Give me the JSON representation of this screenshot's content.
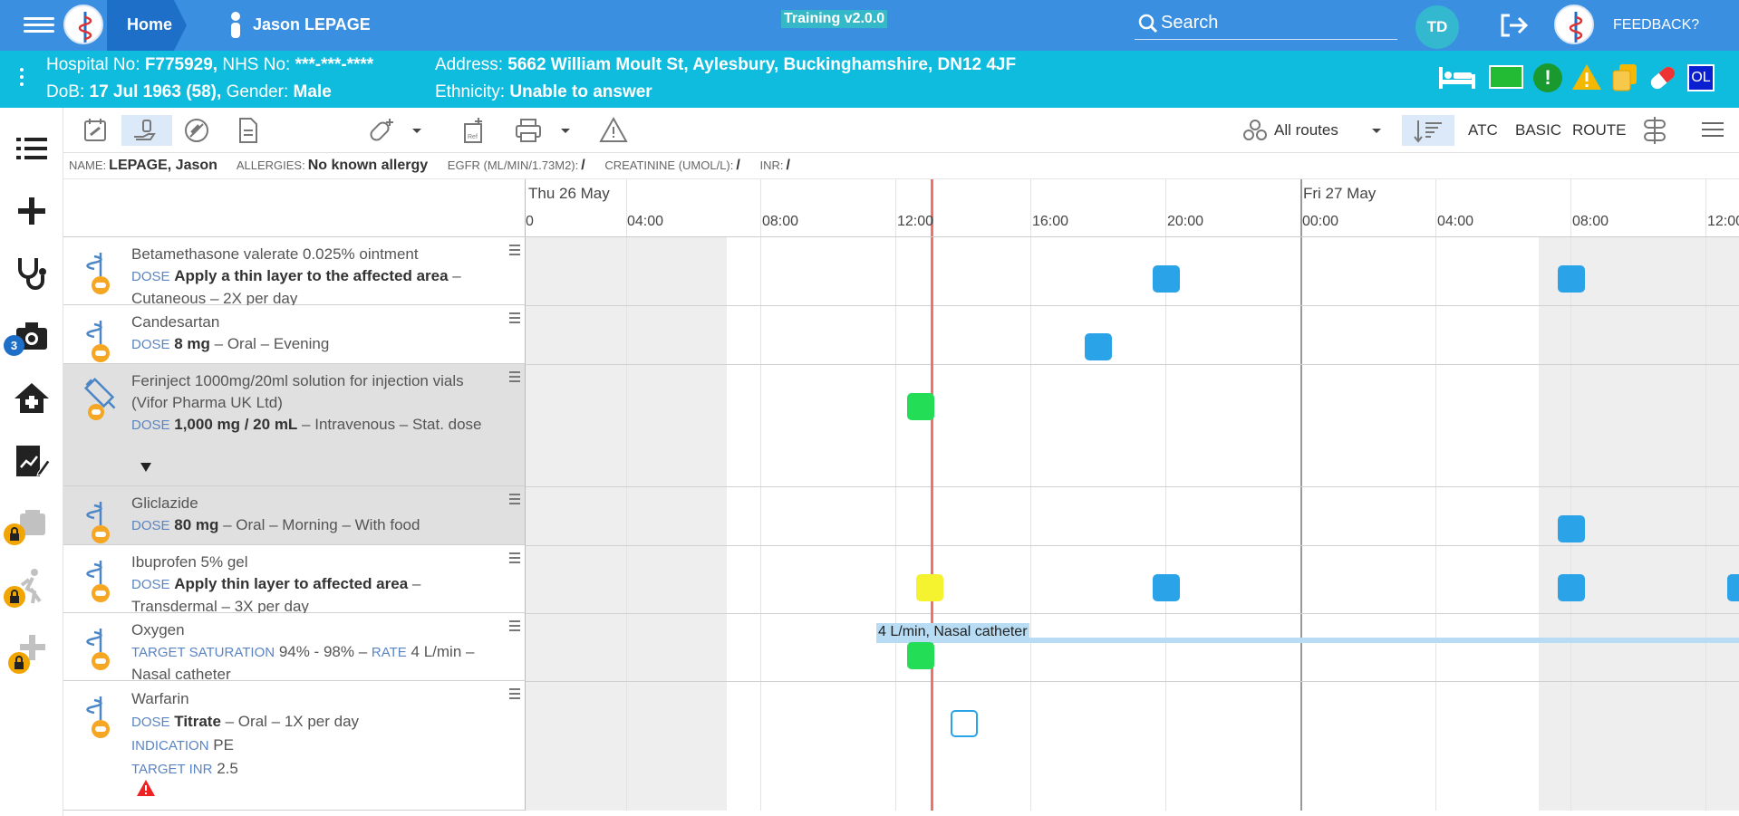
{
  "topbar": {
    "home_label": "Home",
    "patient_name": "Jason LEPAGE",
    "training_label": "Training v2.0.0",
    "search_placeholder": "Search",
    "user_initials": "TD",
    "feedback_label": "FEEDBACK?"
  },
  "patient": {
    "hospital_no_label": "Hospital No:",
    "hospital_no": "F775929,",
    "nhs_label": "NHS No:",
    "nhs_no": "***-***-****",
    "dob_label": "DoB:",
    "dob": "17 Jul 1963 (58),",
    "gender_label": "Gender:",
    "gender": "Male",
    "address_label": "Address:",
    "address": "5662 William Moult St, Aylesbury, Buckinghamshire, DN12 4JF",
    "ethnicity_label": "Ethnicity:",
    "ethnicity": "Unable to answer",
    "status_icons": [
      "bed-icon",
      "green-card-icon",
      "alert-circle-icon",
      "warning-icon",
      "documents-icon",
      "pill-icon",
      "ol-badge"
    ],
    "ol_badge": "OL"
  },
  "sidebar": {
    "camera_badge": "3",
    "icons": [
      "list-icon",
      "plus-icon",
      "stethoscope-icon",
      "camera-icon",
      "home-icon",
      "chart-edit-icon",
      "locked-chart-icon",
      "locked-walk-icon",
      "locked-add-icon"
    ]
  },
  "toolbar": {
    "route_filter": "All routes",
    "sort_atc": "ATC",
    "sort_basic": "BASIC",
    "sort_route": "ROUTE"
  },
  "infobar": {
    "name_label": "NAME:",
    "name": "LEPAGE, Jason",
    "allergies_label": "ALLERGIES:",
    "allergies": "No known allergy",
    "egfr_label": "EGFR (ML/MIN/1.73M2):",
    "egfr": "/",
    "creat_label": "CREATININE (UMOL/L):",
    "creat": "/",
    "inr_label": "INR:",
    "inr": "/"
  },
  "timeline": {
    "days": [
      "Thu 26 May",
      "Fri 27 May"
    ],
    "hours": [
      "0",
      "04:00",
      "08:00",
      "12:00",
      "16:00",
      "20:00",
      "00:00",
      "04:00",
      "08:00",
      "12:00"
    ]
  },
  "drugs": [
    {
      "name": "Betamethasone valerate 0.025% ointment",
      "k1": "DOSE",
      "v1": "Apply a thin layer to the affected area",
      "t1": " – Cutaneous – 2X per day"
    },
    {
      "name": "Candesartan",
      "k1": "DOSE",
      "v1": "8 mg",
      "t1": " – Oral – Evening"
    },
    {
      "name": "Ferinject 1000mg/20ml solution for injection vials (Vifor Pharma UK Ltd)",
      "k1": "DOSE",
      "v1": "1,000 mg / 20 mL",
      "t1": " – Intravenous – Stat. dose"
    },
    {
      "name": "Gliclazide",
      "k1": "DOSE",
      "v1": "80 mg",
      "t1": " – Oral – Morning – With food"
    },
    {
      "name": "Ibuprofen 5% gel",
      "k1": "DOSE",
      "v1": "Apply thin layer to affected area",
      "t1": " – Transdermal – 3X per day"
    },
    {
      "name": "Oxygen",
      "k1": "TARGET SATURATION",
      "v1": "94% - 98%",
      "t1": " – ",
      "k2": "RATE",
      "v2": "4 L/min",
      "t2": " – Nasal catheter"
    },
    {
      "name": "Warfarin",
      "k1": "DOSE",
      "v1": "Titrate",
      "t1": " – Oral – 1X per day",
      "k2": "INDICATION",
      "v2": "PE",
      "k3": "TARGET INR",
      "v3": "2.5"
    }
  ],
  "oxygen_label": "4 L/min, Nasal catheter",
  "colors": {
    "given": "#22dd55",
    "due": "#2ba3e8",
    "late": "#f5f230",
    "now": "#f0706a"
  }
}
